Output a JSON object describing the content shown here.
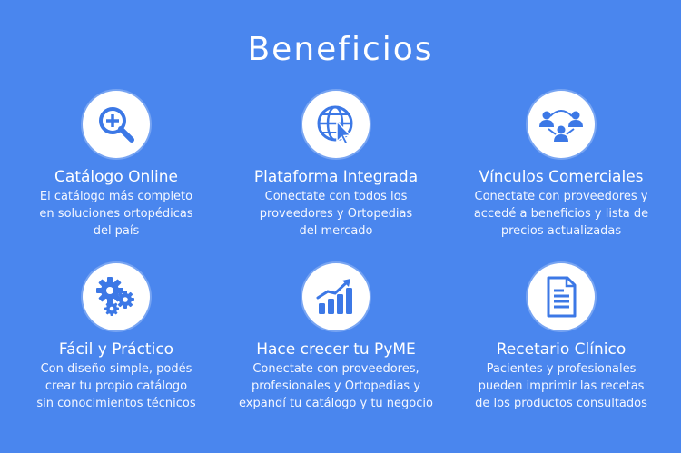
{
  "page": {
    "title": "Beneficios"
  },
  "accent": "#3c78e6",
  "background": "#4a86ee",
  "cards": [
    {
      "icon": "magnifier-plus-icon",
      "title": "Catálogo Online",
      "lines": [
        "El catálogo más completo",
        "en soluciones ortopédicas",
        "del país"
      ]
    },
    {
      "icon": "globe-cursor-icon",
      "title": "Plataforma Integrada",
      "lines": [
        "Conectate con todos los",
        "proveedores y Ortopedias",
        "del mercado"
      ]
    },
    {
      "icon": "people-network-icon",
      "title": "Vínculos Comerciales",
      "lines": [
        "Conectate con proveedores y",
        "accedé a beneficios y lista de",
        "precios actualizadas"
      ]
    },
    {
      "icon": "gears-icon",
      "title": "Fácil y Práctico",
      "lines": [
        "Con diseño simple, podés",
        "crear tu propio catálogo",
        "sin conocimientos técnicos"
      ]
    },
    {
      "icon": "growth-chart-icon",
      "title": "Hace crecer tu PyME",
      "lines": [
        "Conectate con proveedores,",
        "profesionales y Ortopedias y",
        "expandí tu catálogo y tu negocio"
      ]
    },
    {
      "icon": "document-icon",
      "title": "Recetario Clínico",
      "lines": [
        "Pacientes y profesionales",
        "pueden imprimir las recetas",
        "de los productos consultados"
      ]
    }
  ]
}
